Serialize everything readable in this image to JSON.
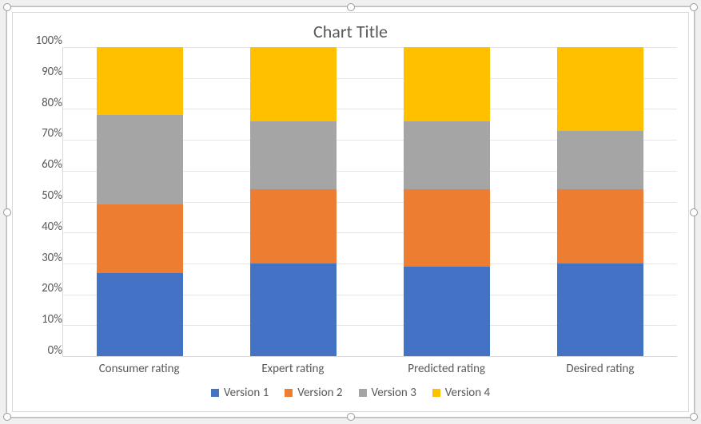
{
  "chart_data": {
    "type": "bar",
    "stacked": true,
    "normalized_to_100": true,
    "title": "Chart Title",
    "xlabel": "",
    "ylabel": "",
    "ylim": [
      0,
      100
    ],
    "y_ticks_percent": [
      0,
      10,
      20,
      30,
      40,
      50,
      60,
      70,
      80,
      90,
      100
    ],
    "y_tick_labels": [
      "0%",
      "10%",
      "20%",
      "30%",
      "40%",
      "50%",
      "60%",
      "70%",
      "80%",
      "90%",
      "100%"
    ],
    "categories": [
      "Consumer rating",
      "Expert rating",
      "Predicted rating",
      "Desired rating"
    ],
    "series": [
      {
        "name": "Version 1",
        "color": "#4472C4",
        "values_percent": [
          27,
          30,
          29,
          30
        ]
      },
      {
        "name": "Version 2",
        "color": "#ED7D31",
        "values_percent": [
          22,
          24,
          25,
          24
        ]
      },
      {
        "name": "Version 3",
        "color": "#A5A5A5",
        "values_percent": [
          29,
          22,
          22,
          19
        ]
      },
      {
        "name": "Version 4",
        "color": "#FFC000",
        "values_percent": [
          22,
          24,
          24,
          27
        ]
      }
    ],
    "legend_position": "bottom",
    "gridlines": true
  }
}
